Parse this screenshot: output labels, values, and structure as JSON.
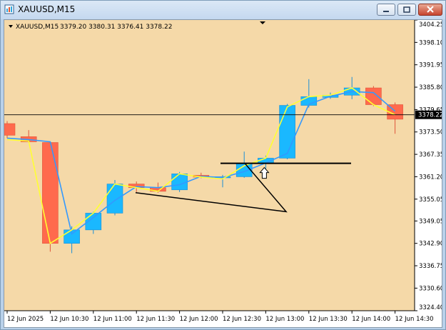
{
  "window": {
    "title": "XAUUSD,M15",
    "controls": [
      "minimize",
      "restore",
      "close"
    ]
  },
  "chart_info": {
    "symbol_line": "XAUUSD,M15",
    "ohlc": "3379.20 3380.31 3376.41 3378.22"
  },
  "colors": {
    "background": "#f5d9a8",
    "bull_fill": "#1ab8ff",
    "bear_fill": "#ff6a4d",
    "ma_fast": "#ffff33",
    "ma_slow": "#3399ff",
    "price_line": "#000000"
  },
  "chart_data": {
    "type": "candlestick",
    "ylim": [
      3324.4,
      3404.25
    ],
    "y_ticks": [
      "3404.25",
      "3398.10",
      "3391.95",
      "3385.80",
      "3379.65",
      "3373.50",
      "3367.35",
      "3361.20",
      "3355.05",
      "3349.05",
      "3342.90",
      "3336.75",
      "3330.60",
      "3324.40"
    ],
    "x_ticks": [
      "12 Jun 2025",
      "12 Jun 10:30",
      "12 Jun 11:00",
      "12 Jun 11:30",
      "12 Jun 12:00",
      "12 Jun 12:30",
      "12 Jun 13:00",
      "12 Jun 13:30",
      "12 Jun 14:00",
      "12 Jun 14:30"
    ],
    "current_price_label": "3378.22",
    "current_price": 3378.22,
    "candles": [
      {
        "o": 3375.8,
        "h": 3376.5,
        "l": 3371.8,
        "c": 3372.6
      },
      {
        "o": 3372.2,
        "h": 3374.0,
        "l": 3370.6,
        "c": 3370.8
      },
      {
        "o": 3370.6,
        "h": 3370.8,
        "l": 3340.6,
        "c": 3342.9
      },
      {
        "o": 3342.9,
        "h": 3347.6,
        "l": 3340.2,
        "c": 3346.6
      },
      {
        "o": 3346.6,
        "h": 3351.6,
        "l": 3345.5,
        "c": 3351.2
      },
      {
        "o": 3351.2,
        "h": 3360.3,
        "l": 3350.6,
        "c": 3359.2
      },
      {
        "o": 3359.2,
        "h": 3359.9,
        "l": 3357.0,
        "c": 3358.2
      },
      {
        "o": 3358.2,
        "h": 3359.6,
        "l": 3356.8,
        "c": 3357.2
      },
      {
        "o": 3357.6,
        "h": 3362.5,
        "l": 3357.0,
        "c": 3362.0
      },
      {
        "o": 3361.6,
        "h": 3362.3,
        "l": 3360.8,
        "c": 3361.1
      },
      {
        "o": 3361.0,
        "h": 3361.7,
        "l": 3358.3,
        "c": 3361.2
      },
      {
        "o": 3361.2,
        "h": 3368.1,
        "l": 3360.9,
        "c": 3364.9
      },
      {
        "o": 3365.0,
        "h": 3367.0,
        "l": 3362.4,
        "c": 3366.3
      },
      {
        "o": 3366.3,
        "h": 3381.2,
        "l": 3366.0,
        "c": 3380.8
      },
      {
        "o": 3380.8,
        "h": 3388.0,
        "l": 3380.2,
        "c": 3383.2
      },
      {
        "o": 3383.0,
        "h": 3384.3,
        "l": 3382.6,
        "c": 3383.6
      },
      {
        "o": 3383.6,
        "h": 3388.6,
        "l": 3382.5,
        "c": 3385.6
      },
      {
        "o": 3385.6,
        "h": 3386.1,
        "l": 3380.6,
        "c": 3381.0
      },
      {
        "o": 3381.0,
        "h": 3381.6,
        "l": 3373.0,
        "c": 3377.0
      }
    ],
    "ma_fast": [
      3371.4,
      3371.0,
      3342.9,
      3346.6,
      3351.2,
      3359.2,
      3358.2,
      3357.2,
      3362.0,
      3361.1,
      3360.6,
      3364.2,
      3366.3,
      3380.4,
      3383.2,
      3383.6,
      3385.6,
      3381.0,
      3378.2
    ],
    "ma_slow": [
      3371.8,
      3371.4,
      3370.8,
      3345.5,
      3350.0,
      3354.7,
      3358.5,
      3358.2,
      3359.0,
      3361.3,
      3361.0,
      3362.6,
      3365.0,
      3367.6,
      3381.1,
      3383.3,
      3384.6,
      3384.3,
      3379.2
    ],
    "annotations": {
      "hline_level": 3364.9,
      "triangle": [
        [
          12,
          3357.8
        ],
        [
          19,
          3351.6
        ],
        [
          17,
          3364.9
        ]
      ],
      "arrow_up_under_candle": 12
    }
  }
}
